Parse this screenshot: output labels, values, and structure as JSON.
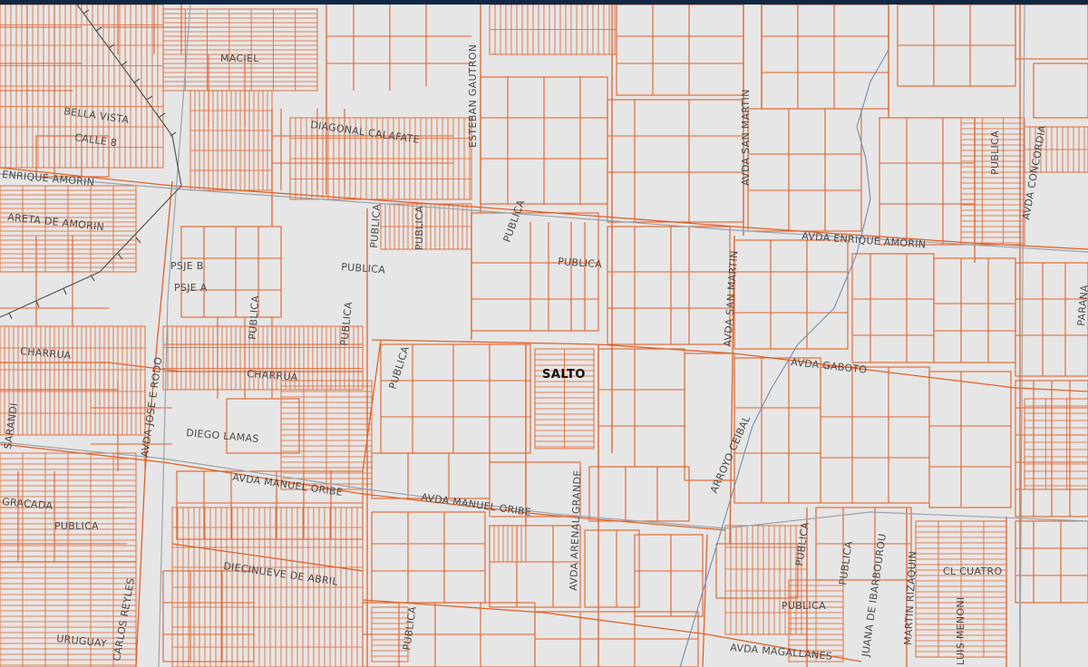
{
  "map": {
    "city_label": "SALTO",
    "colors": {
      "background": "#e6e6e6",
      "parcel": "#e0622a",
      "road": "#9aa3ad",
      "stream": "#6e8fb4",
      "rail": "#555555",
      "label": "#4a4a4a",
      "header": "#0f2846"
    },
    "labels": {
      "maciel": "MACIEL",
      "bella_vista": "BELLA VISTA",
      "calle_8": "CALLE 8",
      "enrique_amorin_w": "ENRIQUE AMORIN",
      "diagonal_calafate": "DIAGONAL CALAFATE",
      "esteban_gautron": "ESTEBAN GAUTRON",
      "avda_san_martin_n": "AVDA SAN MARTIN",
      "avda_concordia": "AVDA CONCORDIA",
      "publica_ne": "PUBLICA",
      "avda_enrique_amorin": "AVDA ENRIQUE AMORIN",
      "publica_center": "PUBLICA",
      "publica_diag": "PUBLICA",
      "publica_mid": "PUBLICA",
      "psje_b": "PSJE B",
      "psje_a": "PSJE A",
      "areta_de_amorin": "ARETA DE AMORIN",
      "avda_san_martin": "AVDA SAN MARTIN",
      "avda_gaboto": "AVDA GABOTO",
      "charrua_w": "CHARRUA",
      "charrua": "CHARRUA",
      "avda_jose_e_rodo": "AVDA JOSE E RODO",
      "diego_lamas": "DIEGO LAMAS",
      "arroyo_ceibal": "ARROYO CEIBAL",
      "avda_manuel_oribe_w": "AVDA MANUEL ORIBE",
      "avda_manuel_oribe": "AVDA MANUEL ORIBE",
      "avda_arenal_grande": "AVDA ARENAL GRANDE",
      "diecinueve_de_abril": "DIECINUEVE DE ABRIL",
      "gracada": "GRACADA",
      "publica_sw": "PUBLICA",
      "carlos_reyles": "CARLOS REYLES",
      "publica_se": "PUBLICA",
      "publica_s": "PUBLICA",
      "publica_ese": "PUBLICA",
      "julia_de_ibarbourou": "JUANA DE IBARBOUROU",
      "martin_rizaquin": "MARTIN RIZAQUIN",
      "cl_cuatro": "CL CUATRO",
      "luis_menoni": "LUIS MENONI",
      "avda_magallanes": "AVDA MAGALLANES",
      "publica_bottom": "PUBLICA",
      "uruguay": "URUGUAY",
      "parana": "PARANA",
      "sarandi": "SARANDI",
      "publica_n1": "PUBLICA",
      "publica_n2": "PUBLICA",
      "publica_w1": "PUBLICA",
      "publica_w2": "PUBLICA",
      "publica_w3": "PUBLICA"
    }
  }
}
